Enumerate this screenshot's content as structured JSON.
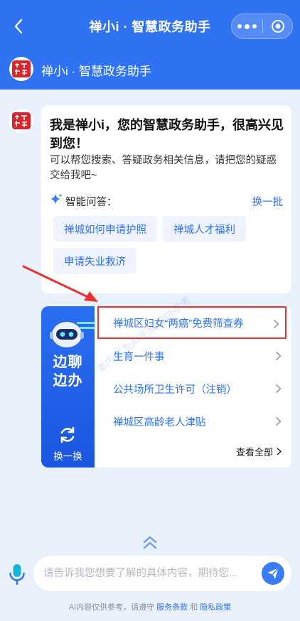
{
  "colors": {
    "brand": "#2f72f2",
    "highlight": "#e8322f",
    "background": "#e9f1fd"
  },
  "nav": {
    "title": "禅小i · 智慧政务助手"
  },
  "subheader": {
    "title": "禅小i · 智慧政务助手"
  },
  "greeting": {
    "title": "我是禅小i，您的智慧政务助手，很高兴见到您！",
    "subtitle": "可以帮您搜索、答疑政务相关信息，请把您的疑惑交给我吧~",
    "qa_label": "智能问答：",
    "swap_label": "换一批",
    "chips": [
      "禅城如何申请护照",
      "禅城人才福利",
      "申请失业救济"
    ]
  },
  "services": {
    "side_title_line1": "边聊",
    "side_title_line2": "边办",
    "refresh_label": "换一换",
    "items": [
      "禅城区妇女“两癌”免费筛查券",
      "生育一件事",
      "公共场所卫生许可（注销）",
      "禅城区高龄老人津贴"
    ],
    "view_all": "查看全部"
  },
  "input": {
    "placeholder": "请告诉我您想要了解的具体内容，期待您..."
  },
  "footer": {
    "prefix": "AI内容仅供参考，请遵守",
    "terms": "服务条款",
    "and": "和",
    "privacy": "隐私政策"
  },
  "watermark": "本内容为AI生成仅供参考"
}
